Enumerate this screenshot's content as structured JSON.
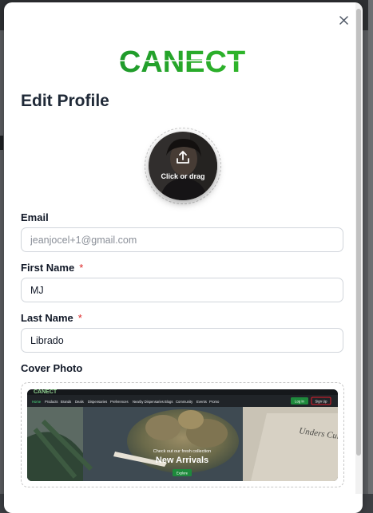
{
  "brand": {
    "logo_text": "CANECT",
    "logo_color": "#22a32c"
  },
  "modal": {
    "title": "Edit Profile",
    "avatar": {
      "upload_hint": "Click or drag"
    },
    "email": {
      "label": "Email",
      "value": "jeanjocel+1@gmail.com"
    },
    "first_name": {
      "label": "First Name",
      "required_mark": "*",
      "value": "MJ"
    },
    "last_name": {
      "label": "Last Name",
      "required_mark": "*",
      "value": "Librado"
    },
    "cover_photo": {
      "label": "Cover Photo",
      "preview": {
        "site_logo": "CANECT",
        "nav_items": [
          "Home",
          "Products",
          "Brands",
          "Deals",
          "Dispensaries",
          "Preferences",
          "Nearby Dispensaries",
          "Blogs",
          "Community",
          "Events",
          "Promo"
        ],
        "login_label": "Log In",
        "signup_label": "Sign Up",
        "tagline": "Check out our fresh collection",
        "headline": "New Arrivals",
        "cta_label": "Explore",
        "bag_text": "Unders Culti Enjoying"
      }
    }
  },
  "colors": {
    "accent_green": "#1e8a3c",
    "required_red": "#dc2626",
    "signup_border": "#e11d2a"
  },
  "icons": {
    "close": "close-icon",
    "upload": "upload-icon"
  }
}
